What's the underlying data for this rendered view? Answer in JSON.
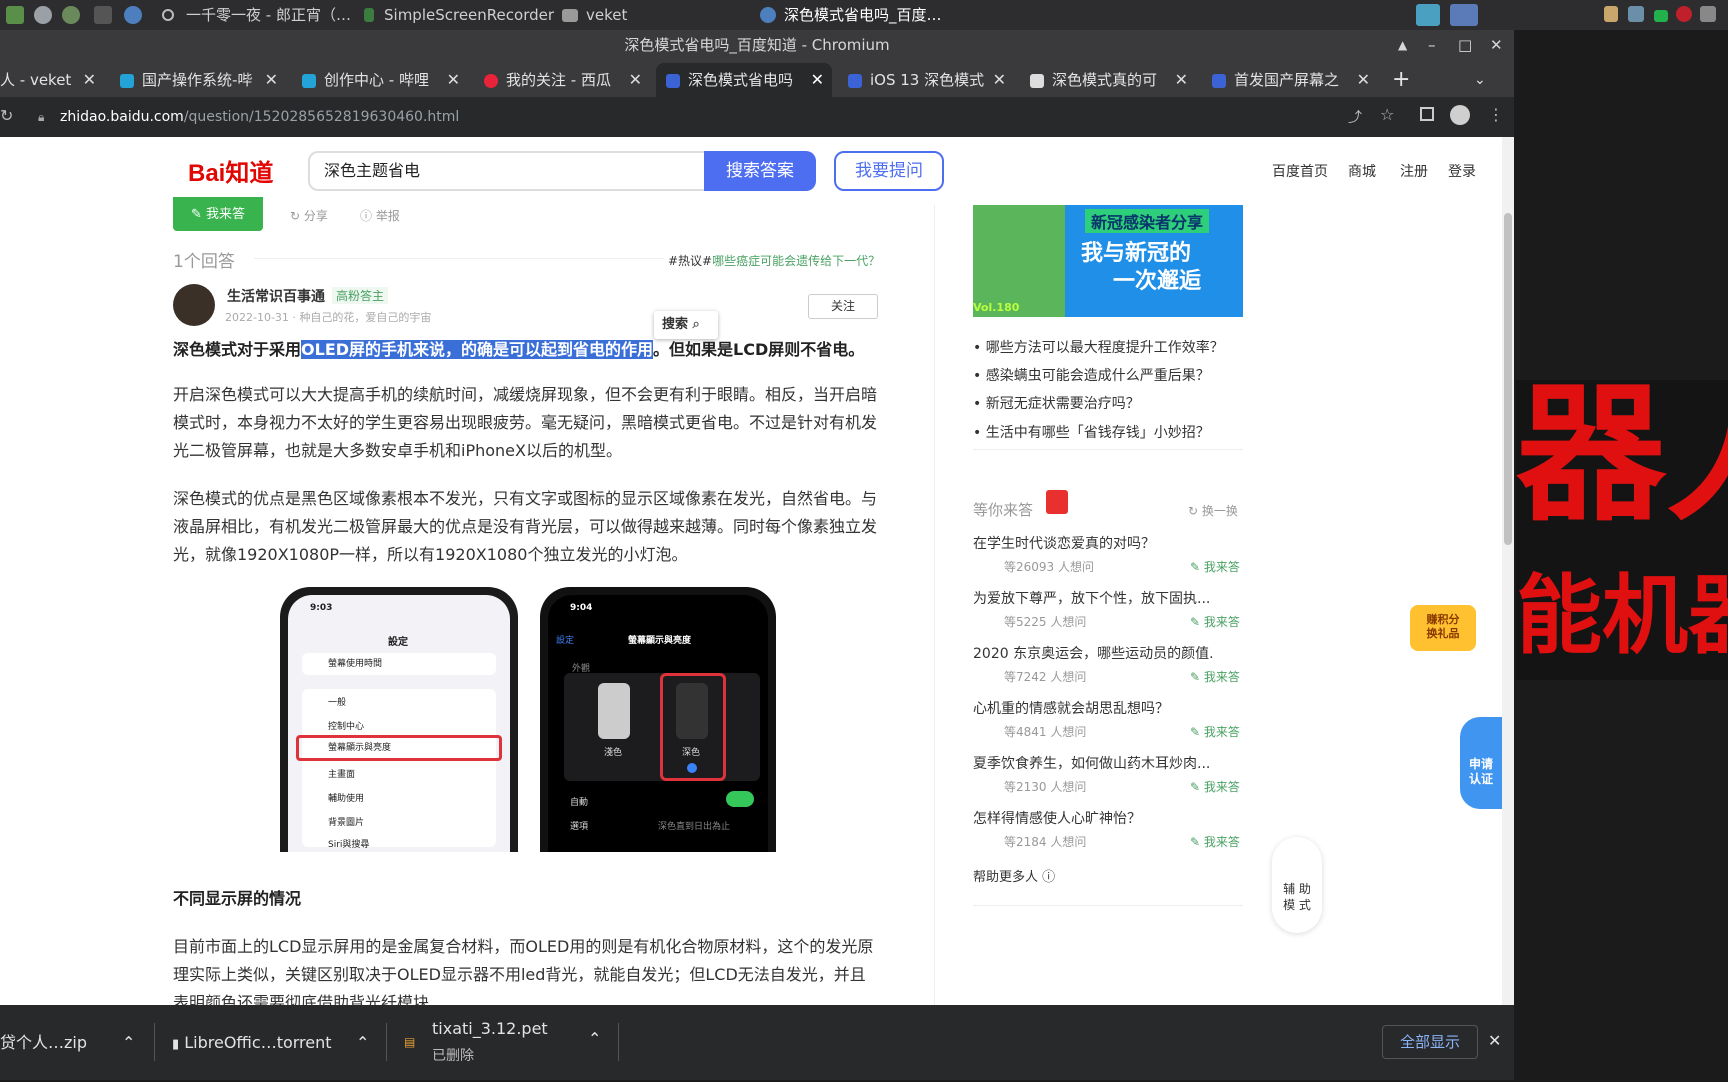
{
  "taskbar": {
    "items": [
      "一千零一夜 - 郎正宵（…",
      "SimpleScreenRecorder",
      "veket",
      "深色模式省电吗_百度…"
    ]
  },
  "window": {
    "title": "深色模式省电吗_百度知道 - Chromium"
  },
  "tabs": [
    {
      "label": "人 - veket"
    },
    {
      "label": "国产操作系统-哔"
    },
    {
      "label": "创作中心 - 哔哩"
    },
    {
      "label": "我的关注 - 西瓜"
    },
    {
      "label": "深色模式省电吗"
    },
    {
      "label": "iOS 13 深色模式"
    },
    {
      "label": "深色模式真的可"
    },
    {
      "label": "首发国产屏幕之"
    }
  ],
  "toolbar": {
    "url_domain": "zhidao.baidu.com",
    "url_path": "/question/1520285652819630460.html"
  },
  "header": {
    "logo": "Bai知道",
    "search_value": "深色主题省电",
    "search_button": "搜索答案",
    "ask_button": "我要提问",
    "nav": [
      "百度首页",
      "商城",
      "注册",
      "登录"
    ]
  },
  "answer_actions": {
    "answer": "我来答",
    "share": "分享",
    "report": "举报"
  },
  "answers_count": "1个回答",
  "hot_topic": {
    "tag": "#热议#",
    "text": "哪些癌症可能会遗传给下一代？"
  },
  "answerer": {
    "name": "生活常识百事通",
    "badge": "高粉答主",
    "date": "2022-10-31",
    "motto": "种自己的花，爱自己的宇宙",
    "follow": "关注"
  },
  "search_popup": "搜索",
  "content": {
    "lead_pre": "深色模式对于采用",
    "lead_highlight": "OLED屏的手机来说，的确是可以起到省电的作用",
    "lead_post": "。但如果是LCD屏则不省电。",
    "p1": "开启深色模式可以大大提高手机的续航时间，减缓烧屏现象，但不会更有利于眼睛。相反，当开启暗模式时，本身视力不太好的学生更容易出现眼疲劳。毫无疑问，黑暗模式更省电。不过是针对有机发光二极管屏幕，也就是大多数安卓手机和iPhoneX以后的机型。",
    "p2": "深色模式的优点是黑色区域像素根本不发光，只有文字或图标的显示区域像素在发光，自然省电。与液晶屏相比，有机发光二极管屏最大的优点是没有背光层，可以做得越来越薄。同时每个像素独立发光，就像1920X1080P一样，所以有1920X1080个独立发光的小灯泡。",
    "subheading": "不同显示屏的情况",
    "p3": "目前市面上的LCD显示屏用的是金属复合材料，而OLED用的则是有机化合物原材料，这个的发光原理实际上类似，关键区别取决于OLED显示器不用led背光，就能自发光；但LCD无法自发光，并且表明颜色还需要彻底借助背光纤模块"
  },
  "phone_left": {
    "time": "9:03",
    "title": "設定",
    "items": [
      "螢幕使用時間",
      "一般",
      "控制中心",
      "螢幕顯示與亮度",
      "主畫面",
      "輔助使用",
      "背景圖片",
      "Siri與搜尋"
    ]
  },
  "phone_right": {
    "time": "9:04",
    "back": "設定",
    "title": "螢幕顯示與亮度",
    "section": "外觀",
    "light": "淺色",
    "dark": "深色",
    "auto": "自動",
    "options": "選項",
    "options_value": "深色直到日出為止"
  },
  "sidebar": {
    "banner_line1": "新冠感染者分享",
    "banner_line2": "我与新冠的",
    "banner_line3": "一次邂逅",
    "banner_vol": "Vol.180",
    "questions": [
      "哪些方法可以最大程度提升工作效率？",
      "感染螨虫可能会造成什么严重后果？",
      "新冠无症状需要治疗吗？",
      "生活中有哪些「省钱存钱」小妙招？"
    ],
    "waiting_title": "等你来答",
    "refresh": "换一换",
    "waiting": [
      {
        "q": "在学生时代谈恋爱真的对吗？",
        "count": "等26093 人想问"
      },
      {
        "q": "为爱放下尊严，放下个性，放下固执...",
        "count": "等5225 人想问"
      },
      {
        "q": "2020 东京奥运会，哪些运动员的颜值...",
        "count": "等7242 人想问"
      },
      {
        "q": "心机重的情感就会胡思乱想吗？",
        "count": "等4841 人想问"
      },
      {
        "q": "夏季饮食养生，如何做山药木耳炒肉...",
        "count": "等2130 人想问"
      },
      {
        "q": "怎样得情感使人心旷神怡？",
        "count": "等2184 人想问"
      }
    ],
    "answer_label": "我来答",
    "help_more": "帮助更多人"
  },
  "floating": {
    "points": "赚积分\n换礼品",
    "apply": "申请\n认证",
    "assist": "辅 助\n模 式"
  },
  "background_text": {
    "line1": "器人",
    "line2": "能机器"
  },
  "downloads": {
    "items": [
      {
        "name": "贷个人…zip"
      },
      {
        "name": "LibreOffic…torrent"
      },
      {
        "name": "tixati_3.12.pet",
        "status": "已删除"
      }
    ],
    "show_all": "全部显示"
  }
}
